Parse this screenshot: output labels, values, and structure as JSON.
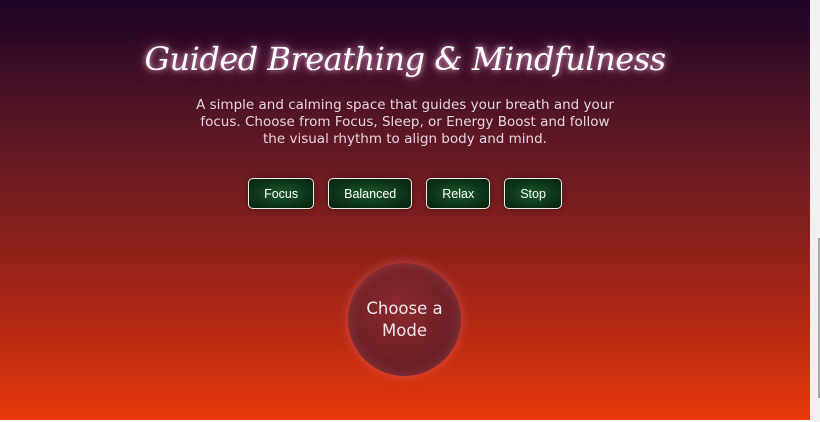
{
  "header": {
    "title": "Guided Breathing & Mindfulness",
    "subtitle": "A simple and calming space that guides your breath and your focus. Choose from Focus, Sleep, or Energy Boost and follow the visual rhythm to align body and mind."
  },
  "controls": {
    "buttons": [
      {
        "label": "Focus"
      },
      {
        "label": "Balanced"
      },
      {
        "label": "Relax"
      },
      {
        "label": "Stop"
      }
    ]
  },
  "orb": {
    "text": "Choose a Mode"
  },
  "colors": {
    "background_top": "#1a0424",
    "background_bottom": "#e8380a",
    "button_fill": "#0d3418",
    "button_border": "#e9ecea",
    "orb_fill": "#6f2026"
  }
}
